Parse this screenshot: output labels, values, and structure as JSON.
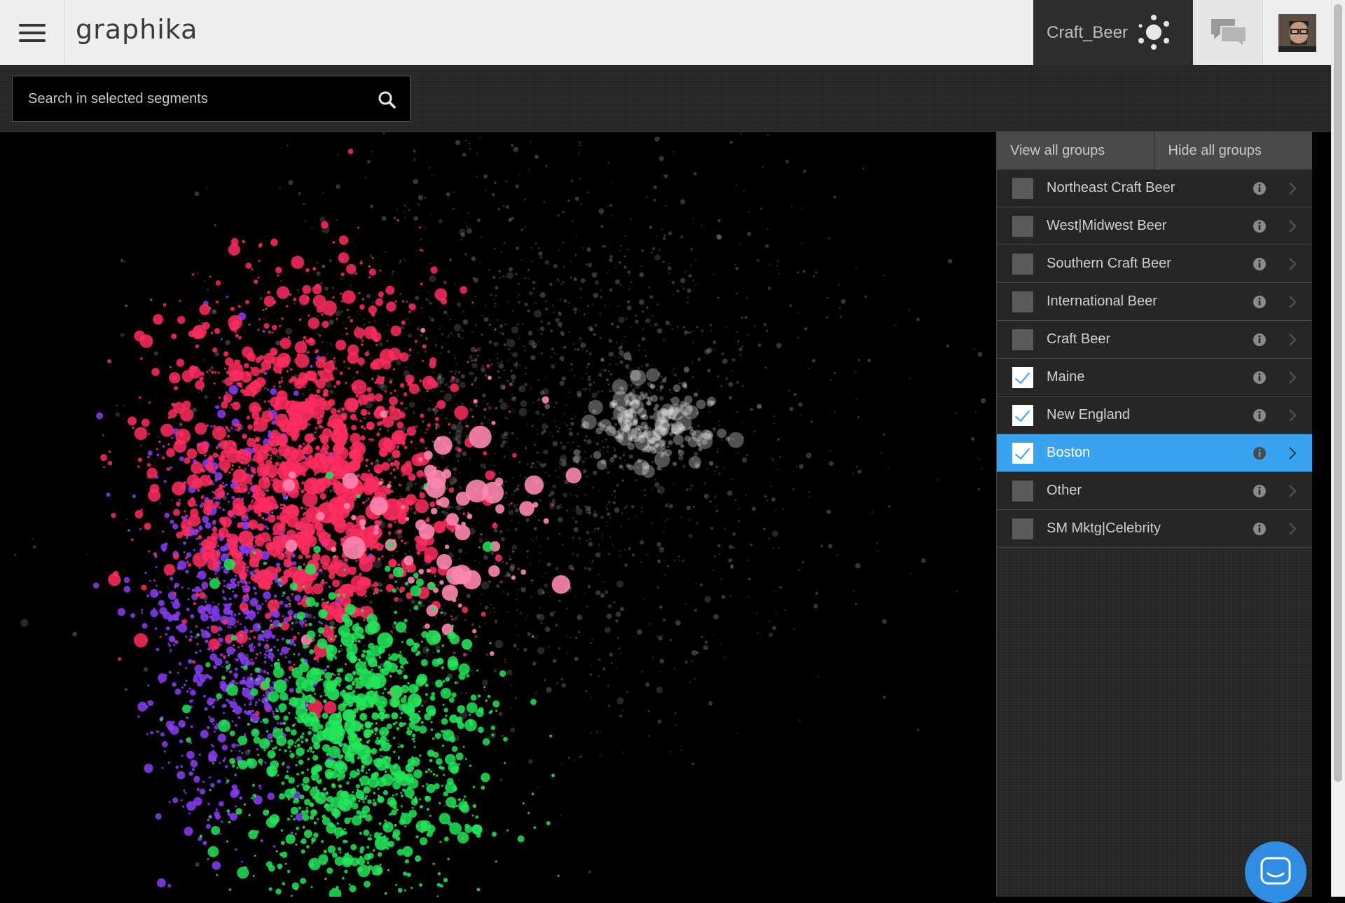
{
  "header": {
    "logo": "graphika",
    "project_name": "Craft_Beer",
    "icons": {
      "menu": "hamburger-menu-icon",
      "network": "network-graph-icon",
      "chat": "chat-bubbles-icon",
      "avatar": "user-avatar"
    }
  },
  "search": {
    "placeholder": "Search in selected segments",
    "icon": "search-icon"
  },
  "panel": {
    "view_all_label": "View all groups",
    "hide_all_label": "Hide all groups",
    "groups": [
      {
        "label": "Northeast Craft Beer",
        "checked": false,
        "selected": false
      },
      {
        "label": "West|Midwest Beer",
        "checked": false,
        "selected": false
      },
      {
        "label": "Southern Craft Beer",
        "checked": false,
        "selected": false
      },
      {
        "label": "International Beer",
        "checked": false,
        "selected": false
      },
      {
        "label": "Craft Beer",
        "checked": false,
        "selected": false
      },
      {
        "label": "Maine",
        "checked": true,
        "selected": false
      },
      {
        "label": "New England",
        "checked": true,
        "selected": false
      },
      {
        "label": "Boston",
        "checked": true,
        "selected": true
      },
      {
        "label": "Other",
        "checked": false,
        "selected": false
      },
      {
        "label": "SM Mktg|Celebrity",
        "checked": false,
        "selected": false
      }
    ]
  },
  "colors": {
    "selected_row": "#3aa3f0",
    "cluster_red": "#ff2d5f",
    "cluster_pink": "#ff86b0",
    "cluster_purple": "#8a3cf5",
    "cluster_green": "#22e45a",
    "cluster_gray": "#9a9a9a",
    "chat_fab": "#2f8de4"
  }
}
